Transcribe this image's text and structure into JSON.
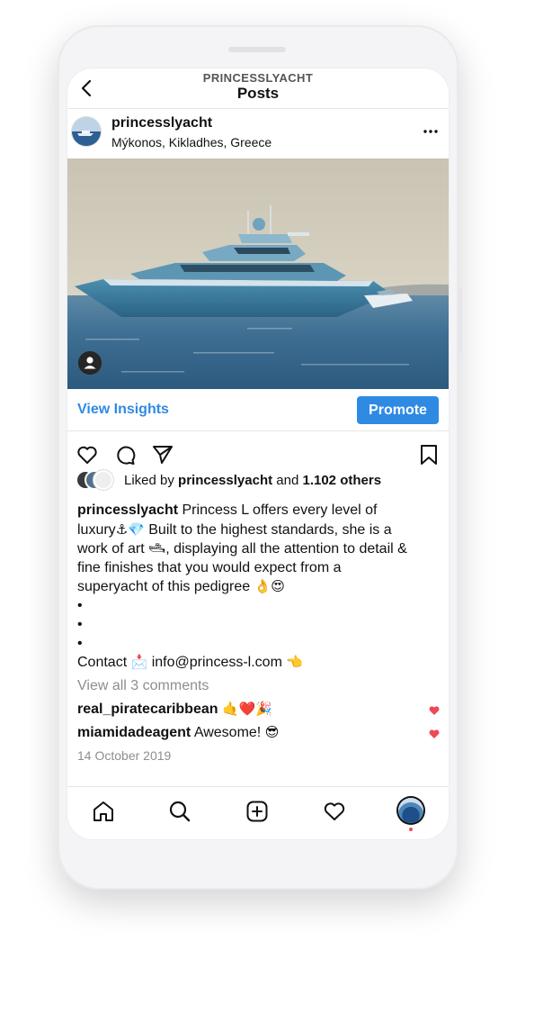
{
  "header": {
    "account": "PRINCESSLYACHT",
    "title": "Posts"
  },
  "post": {
    "username": "princesslyacht",
    "location": "Mýkonos, Kikladhes, Greece"
  },
  "insights": {
    "view_label": "View Insights",
    "promote_label": "Promote"
  },
  "likes": {
    "prefix": "Liked by ",
    "user": "princesslyacht",
    "middle": " and ",
    "others": "1.102 others"
  },
  "caption": {
    "username": "princesslyacht",
    "line1": " Princess L offers every level of",
    "line2": "luxury",
    "line2_emoji": "⚓💎",
    "line2_rest": " Built to the highest standards, she is a",
    "line3a": "work of art ",
    "line3_emoji": "🛥",
    "line3b": ", displaying all the attention to detail &",
    "line4": "fine finishes that you would expect from a",
    "line5": "superyacht of this pedigree ",
    "line5_emoji": "👌😍",
    "dot": "•"
  },
  "contact": {
    "label": "Contact ",
    "emoji": "📩",
    "email": " info@princess-l.com ",
    "pointer": "👈"
  },
  "comments": {
    "view_all": "View all 3 comments",
    "items": [
      {
        "user": "real_piratecaribbean",
        "text": " ",
        "emoji": "🤙❤️🎉"
      },
      {
        "user": "miamidadeagent",
        "text": " Awesome! ",
        "emoji": "😎"
      }
    ]
  },
  "date": "14 October 2019",
  "colors": {
    "accent": "#2f8ae4",
    "like_red": "#ed4956",
    "muted": "#8e8e8e"
  },
  "icons": [
    "back-arrow-icon",
    "more-icon",
    "person-tag-icon",
    "heart-icon",
    "comment-icon",
    "share-icon",
    "bookmark-icon",
    "home-icon",
    "search-icon",
    "add-post-icon",
    "activity-heart-icon",
    "profile-avatar"
  ]
}
